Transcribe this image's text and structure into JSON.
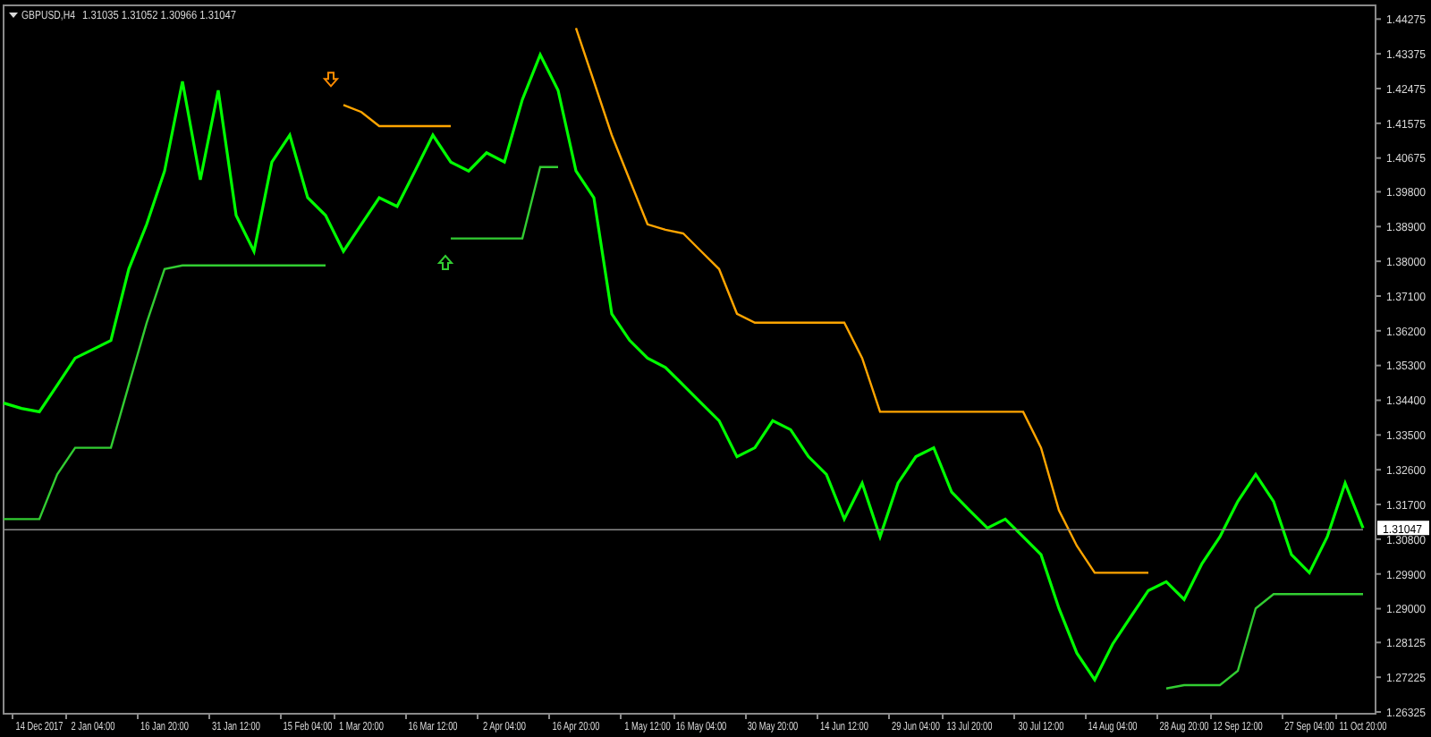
{
  "header": {
    "symbol": "GBPUSD,H4",
    "quotes": [
      "1.31035",
      "1.31052",
      "1.30966",
      "1.31047"
    ]
  },
  "chart": {
    "current_price": "1.31047",
    "signals": [
      {
        "kind": "sell",
        "color": "#ff8c00"
      },
      {
        "kind": "buy",
        "color": "#32cd32"
      }
    ],
    "chart_data": {
      "type": "line",
      "categories": [
        null,
        null,
        "14 Dec 2017",
        null,
        null,
        "2 Jan 04:00",
        null,
        null,
        null,
        "16 Jan 20:00",
        null,
        null,
        null,
        "31 Jan 12:00",
        null,
        null,
        null,
        "15 Feb 04:00",
        null,
        null,
        "1 Mar 20:00",
        null,
        null,
        null,
        "16 Mar 12:00",
        null,
        null,
        null,
        "2 Apr 04:00",
        null,
        null,
        null,
        "16 Apr 20:00",
        null,
        null,
        null,
        "1 May 12:00",
        null,
        null,
        "16 May 04:00",
        null,
        null,
        null,
        "30 May 20:00",
        null,
        null,
        null,
        "14 Jun 12:00",
        null,
        null,
        null,
        "29 Jun 04:00",
        null,
        null,
        "13 Jul 20:00",
        null,
        null,
        null,
        "30 Jul 12:00",
        null,
        null,
        null,
        "14 Aug 04:00",
        null,
        null,
        null,
        "28 Aug 20:00",
        null,
        null,
        "12 Sep 12:00",
        null,
        null,
        null,
        "27 Sep 04:00",
        null,
        null,
        "11 Oct 20:00"
      ],
      "ylim": [
        1.26325,
        1.4463
      ],
      "yticks": [
        {
          "value": 1.44275,
          "label": "1.44275"
        },
        {
          "value": 1.43375,
          "label": "1.43375"
        },
        {
          "value": 1.42475,
          "label": "1.42475"
        },
        {
          "value": 1.41575,
          "label": "1.41575"
        },
        {
          "value": 1.40675,
          "label": "1.40675"
        },
        {
          "value": 1.398,
          "label": "1.39800"
        },
        {
          "value": 1.389,
          "label": "1.38900"
        },
        {
          "value": 1.38,
          "label": "1.38000"
        },
        {
          "value": 1.371,
          "label": "1.37100"
        },
        {
          "value": 1.362,
          "label": "1.36200"
        },
        {
          "value": 1.353,
          "label": "1.35300"
        },
        {
          "value": 1.344,
          "label": "1.34400"
        },
        {
          "value": 1.335,
          "label": "1.33500"
        },
        {
          "value": 1.326,
          "label": "1.32600"
        },
        {
          "value": 1.317,
          "label": "1.31700"
        },
        {
          "value": 1.308,
          "label": "1.30800"
        },
        {
          "value": 1.299,
          "label": "1.29900"
        },
        {
          "value": 1.29,
          "label": "1.29000"
        },
        {
          "value": 1.28125,
          "label": "1.28125"
        },
        {
          "value": 1.27225,
          "label": "1.27225"
        },
        {
          "value": 1.26325,
          "label": "1.26325"
        }
      ],
      "series": [
        {
          "color": "#00ff00",
          "values": [
            1.3433,
            1.3419,
            1.341,
            1.3479,
            1.3549,
            1.3572,
            1.3595,
            1.378,
            1.3896,
            1.4034,
            1.4266,
            1.4011,
            1.4243,
            1.3919,
            1.3826,
            1.4057,
            1.4127,
            1.3965,
            1.3919,
            1.3826,
            1.3896,
            1.3965,
            1.3942,
            1.4034,
            1.4127,
            1.4057,
            1.4034,
            1.4081,
            1.4057,
            1.4219,
            1.4335,
            1.4243,
            1.4034,
            1.3965,
            1.3664,
            1.3595,
            1.3549,
            1.3525,
            1.3479,
            1.3433,
            1.3387,
            1.3294,
            1.3317,
            1.3387,
            1.3364,
            1.3294,
            1.3248,
            1.3132,
            1.3225,
            1.3086,
            1.3225,
            1.3294,
            1.3317,
            1.3202,
            1.3155,
            1.3109,
            1.3132,
            1.3086,
            1.304,
            1.2901,
            1.2785,
            1.2716,
            1.2808,
            1.2878,
            1.2947,
            1.297,
            1.2924,
            1.3017,
            1.3086,
            1.3178,
            1.3248,
            1.3178,
            1.304,
            1.2993,
            1.3086,
            1.3225,
            1.3109
          ]
        },
        {
          "color": "#ffa500",
          "values": [
            null,
            null,
            null,
            null,
            null,
            null,
            null,
            null,
            null,
            null,
            null,
            null,
            null,
            null,
            null,
            null,
            null,
            null,
            null,
            1.4205,
            1.4187,
            1.415,
            1.415,
            1.415,
            1.415,
            1.415,
            null,
            null,
            null,
            null,
            null,
            null,
            1.4404,
            1.4266,
            1.4127,
            1.4011,
            1.3896,
            1.3882,
            1.3872,
            1.3826,
            1.378,
            1.3664,
            1.3641,
            1.3641,
            1.3641,
            1.3641,
            1.3641,
            1.3641,
            1.3549,
            1.341,
            1.341,
            1.341,
            1.341,
            1.341,
            1.341,
            1.341,
            1.341,
            1.341,
            1.3317,
            1.3155,
            1.3063,
            1.2993,
            1.2993,
            1.2993,
            1.2993,
            null,
            null,
            null,
            null,
            null,
            null,
            null,
            null,
            null,
            null,
            null,
            null
          ]
        },
        {
          "color": "#32cd32",
          "values": [
            1.3132,
            1.3132,
            1.3132,
            1.3248,
            1.3317,
            1.3317,
            1.3317,
            1.3479,
            1.3641,
            1.378,
            1.3789,
            1.3789,
            1.3789,
            1.3789,
            1.3789,
            1.3789,
            1.3789,
            1.3789,
            1.3789,
            null,
            null,
            null,
            null,
            null,
            null,
            1.3859,
            1.3859,
            1.3859,
            1.3859,
            1.3859,
            1.4044,
            1.4044,
            null,
            null,
            null,
            null,
            null,
            null,
            null,
            null,
            null,
            null,
            null,
            null,
            null,
            null,
            null,
            null,
            null,
            null,
            null,
            null,
            null,
            null,
            null,
            null,
            null,
            null,
            null,
            null,
            null,
            null,
            null,
            null,
            null,
            1.2693,
            1.2702,
            1.2702,
            1.2702,
            1.2739,
            1.2901,
            1.2938,
            1.2938,
            1.2938,
            1.2938,
            1.2938,
            1.2938
          ]
        },
        {
          "color": "#8a8a8a",
          "values": [
            1.31047,
            1.31047,
            1.31047,
            1.31047,
            1.31047,
            1.31047,
            1.31047,
            1.31047,
            1.31047,
            1.31047,
            1.31047,
            1.31047,
            1.31047,
            1.31047,
            1.31047,
            1.31047,
            1.31047,
            1.31047,
            1.31047,
            1.31047,
            1.31047,
            1.31047,
            1.31047,
            1.31047,
            1.31047,
            1.31047,
            1.31047,
            1.31047,
            1.31047,
            1.31047,
            1.31047,
            1.31047,
            1.31047,
            1.31047,
            1.31047,
            1.31047,
            1.31047,
            1.31047,
            1.31047,
            1.31047,
            1.31047,
            1.31047,
            1.31047,
            1.31047,
            1.31047,
            1.31047,
            1.31047,
            1.31047,
            1.31047,
            1.31047,
            1.31047,
            1.31047,
            1.31047,
            1.31047,
            1.31047,
            1.31047,
            1.31047,
            1.31047,
            1.31047,
            1.31047,
            1.31047,
            1.31047,
            1.31047,
            1.31047,
            1.31047,
            1.31047,
            1.31047,
            1.31047,
            1.31047,
            1.31047,
            1.31047,
            1.31047,
            1.31047,
            1.31047,
            1.31047,
            1.31047,
            1.31047
          ]
        }
      ]
    }
  }
}
